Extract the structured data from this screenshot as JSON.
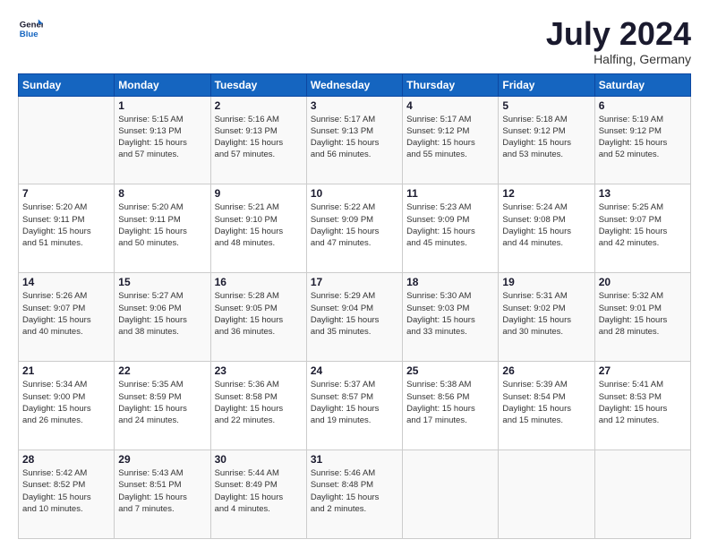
{
  "logo": {
    "line1": "General",
    "line2": "Blue"
  },
  "title": "July 2024",
  "location": "Halfing, Germany",
  "days_header": [
    "Sunday",
    "Monday",
    "Tuesday",
    "Wednesday",
    "Thursday",
    "Friday",
    "Saturday"
  ],
  "weeks": [
    [
      {
        "day": "",
        "info": ""
      },
      {
        "day": "1",
        "info": "Sunrise: 5:15 AM\nSunset: 9:13 PM\nDaylight: 15 hours\nand 57 minutes."
      },
      {
        "day": "2",
        "info": "Sunrise: 5:16 AM\nSunset: 9:13 PM\nDaylight: 15 hours\nand 57 minutes."
      },
      {
        "day": "3",
        "info": "Sunrise: 5:17 AM\nSunset: 9:13 PM\nDaylight: 15 hours\nand 56 minutes."
      },
      {
        "day": "4",
        "info": "Sunrise: 5:17 AM\nSunset: 9:12 PM\nDaylight: 15 hours\nand 55 minutes."
      },
      {
        "day": "5",
        "info": "Sunrise: 5:18 AM\nSunset: 9:12 PM\nDaylight: 15 hours\nand 53 minutes."
      },
      {
        "day": "6",
        "info": "Sunrise: 5:19 AM\nSunset: 9:12 PM\nDaylight: 15 hours\nand 52 minutes."
      }
    ],
    [
      {
        "day": "7",
        "info": "Sunrise: 5:20 AM\nSunset: 9:11 PM\nDaylight: 15 hours\nand 51 minutes."
      },
      {
        "day": "8",
        "info": "Sunrise: 5:20 AM\nSunset: 9:11 PM\nDaylight: 15 hours\nand 50 minutes."
      },
      {
        "day": "9",
        "info": "Sunrise: 5:21 AM\nSunset: 9:10 PM\nDaylight: 15 hours\nand 48 minutes."
      },
      {
        "day": "10",
        "info": "Sunrise: 5:22 AM\nSunset: 9:09 PM\nDaylight: 15 hours\nand 47 minutes."
      },
      {
        "day": "11",
        "info": "Sunrise: 5:23 AM\nSunset: 9:09 PM\nDaylight: 15 hours\nand 45 minutes."
      },
      {
        "day": "12",
        "info": "Sunrise: 5:24 AM\nSunset: 9:08 PM\nDaylight: 15 hours\nand 44 minutes."
      },
      {
        "day": "13",
        "info": "Sunrise: 5:25 AM\nSunset: 9:07 PM\nDaylight: 15 hours\nand 42 minutes."
      }
    ],
    [
      {
        "day": "14",
        "info": "Sunrise: 5:26 AM\nSunset: 9:07 PM\nDaylight: 15 hours\nand 40 minutes."
      },
      {
        "day": "15",
        "info": "Sunrise: 5:27 AM\nSunset: 9:06 PM\nDaylight: 15 hours\nand 38 minutes."
      },
      {
        "day": "16",
        "info": "Sunrise: 5:28 AM\nSunset: 9:05 PM\nDaylight: 15 hours\nand 36 minutes."
      },
      {
        "day": "17",
        "info": "Sunrise: 5:29 AM\nSunset: 9:04 PM\nDaylight: 15 hours\nand 35 minutes."
      },
      {
        "day": "18",
        "info": "Sunrise: 5:30 AM\nSunset: 9:03 PM\nDaylight: 15 hours\nand 33 minutes."
      },
      {
        "day": "19",
        "info": "Sunrise: 5:31 AM\nSunset: 9:02 PM\nDaylight: 15 hours\nand 30 minutes."
      },
      {
        "day": "20",
        "info": "Sunrise: 5:32 AM\nSunset: 9:01 PM\nDaylight: 15 hours\nand 28 minutes."
      }
    ],
    [
      {
        "day": "21",
        "info": "Sunrise: 5:34 AM\nSunset: 9:00 PM\nDaylight: 15 hours\nand 26 minutes."
      },
      {
        "day": "22",
        "info": "Sunrise: 5:35 AM\nSunset: 8:59 PM\nDaylight: 15 hours\nand 24 minutes."
      },
      {
        "day": "23",
        "info": "Sunrise: 5:36 AM\nSunset: 8:58 PM\nDaylight: 15 hours\nand 22 minutes."
      },
      {
        "day": "24",
        "info": "Sunrise: 5:37 AM\nSunset: 8:57 PM\nDaylight: 15 hours\nand 19 minutes."
      },
      {
        "day": "25",
        "info": "Sunrise: 5:38 AM\nSunset: 8:56 PM\nDaylight: 15 hours\nand 17 minutes."
      },
      {
        "day": "26",
        "info": "Sunrise: 5:39 AM\nSunset: 8:54 PM\nDaylight: 15 hours\nand 15 minutes."
      },
      {
        "day": "27",
        "info": "Sunrise: 5:41 AM\nSunset: 8:53 PM\nDaylight: 15 hours\nand 12 minutes."
      }
    ],
    [
      {
        "day": "28",
        "info": "Sunrise: 5:42 AM\nSunset: 8:52 PM\nDaylight: 15 hours\nand 10 minutes."
      },
      {
        "day": "29",
        "info": "Sunrise: 5:43 AM\nSunset: 8:51 PM\nDaylight: 15 hours\nand 7 minutes."
      },
      {
        "day": "30",
        "info": "Sunrise: 5:44 AM\nSunset: 8:49 PM\nDaylight: 15 hours\nand 4 minutes."
      },
      {
        "day": "31",
        "info": "Sunrise: 5:46 AM\nSunset: 8:48 PM\nDaylight: 15 hours\nand 2 minutes."
      },
      {
        "day": "",
        "info": ""
      },
      {
        "day": "",
        "info": ""
      },
      {
        "day": "",
        "info": ""
      }
    ]
  ]
}
